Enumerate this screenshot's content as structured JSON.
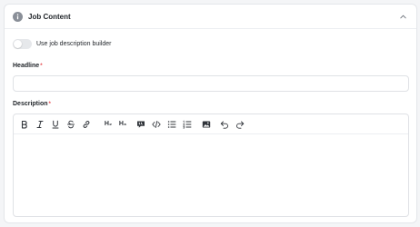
{
  "section": {
    "title": "Job Content",
    "icons": {
      "info": "info-icon",
      "collapse": "chevron-up-icon"
    }
  },
  "toggle": {
    "label": "Use job description builder",
    "checked": false
  },
  "headline": {
    "label": "Headline",
    "required_mark": "*",
    "value": "",
    "placeholder": ""
  },
  "description": {
    "label": "Description",
    "required_mark": "*",
    "value": "",
    "toolbar": [
      {
        "name": "bold",
        "icon": "bold-icon"
      },
      {
        "name": "italic",
        "icon": "italic-icon"
      },
      {
        "name": "underline",
        "icon": "underline-icon"
      },
      {
        "name": "strikethrough",
        "icon": "strikethrough-icon"
      },
      {
        "name": "link",
        "icon": "link-icon"
      },
      {
        "name": "heading-2",
        "text": "H₂"
      },
      {
        "name": "heading-3",
        "text": "H₃"
      },
      {
        "name": "quote",
        "icon": "quote-icon"
      },
      {
        "name": "code",
        "icon": "code-icon"
      },
      {
        "name": "bullet-list",
        "icon": "bullet-list-icon"
      },
      {
        "name": "ordered-list",
        "icon": "ordered-list-icon"
      },
      {
        "name": "image",
        "icon": "image-icon"
      },
      {
        "name": "undo",
        "icon": "undo-icon"
      },
      {
        "name": "redo",
        "icon": "redo-icon"
      }
    ]
  },
  "colors": {
    "required": "#e5484d",
    "border": "#dfe1e5",
    "toggle_off": "#e6e8eb",
    "icon": "#30343a"
  }
}
